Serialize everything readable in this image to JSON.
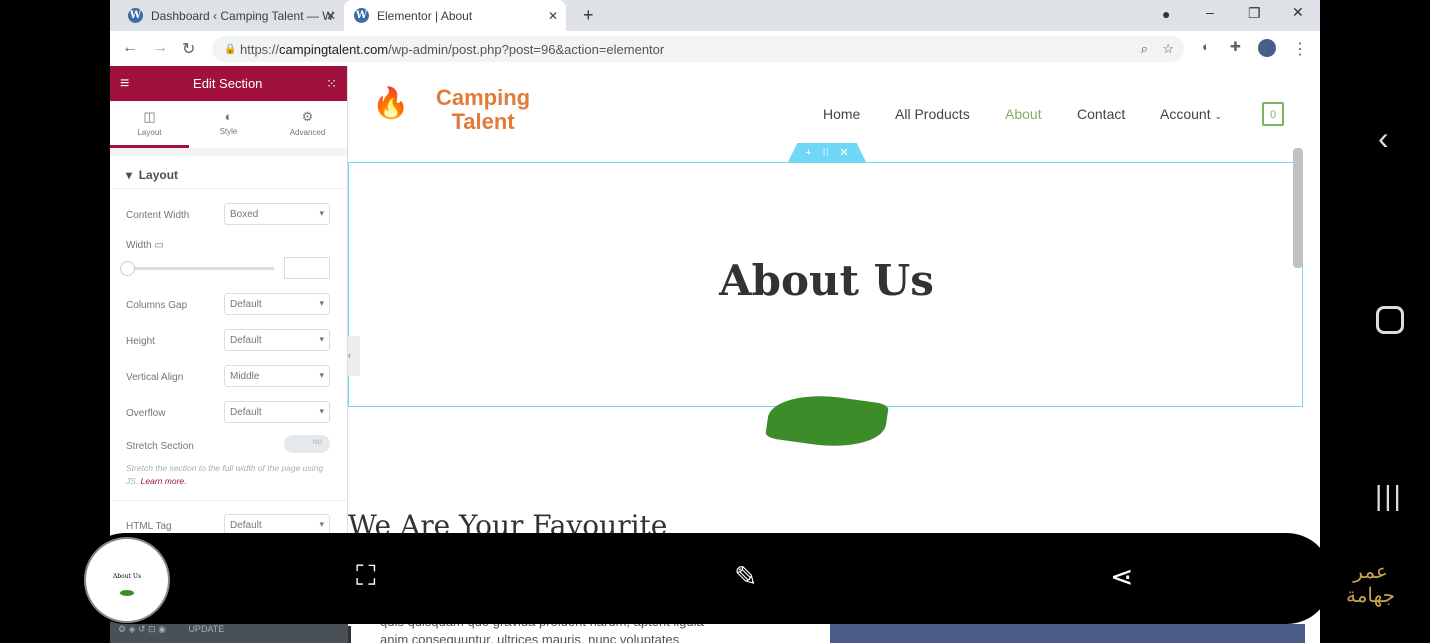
{
  "browser": {
    "tabs": [
      {
        "title": "Dashboard ‹ Camping Talent — W"
      },
      {
        "title": "Elementor | About"
      }
    ],
    "url_prefix": "https://",
    "url_domain": "campingtalent.com",
    "url_path": "/wp-admin/post.php?post=96&action=elementor"
  },
  "panel": {
    "title": "Edit Section",
    "tabs": [
      {
        "label": "Layout",
        "icon": "columns-icon"
      },
      {
        "label": "Style",
        "icon": "half-circle-icon"
      },
      {
        "label": "Advanced",
        "icon": "gear-icon"
      }
    ],
    "section_title": "Layout",
    "fields": {
      "content_width": {
        "label": "Content Width",
        "value": "Boxed"
      },
      "width": {
        "label": "Width"
      },
      "columns_gap": {
        "label": "Columns Gap",
        "value": "Default"
      },
      "height": {
        "label": "Height",
        "value": "Default"
      },
      "vertical_align": {
        "label": "Vertical Align",
        "value": "Middle"
      },
      "overflow": {
        "label": "Overflow",
        "value": "Default"
      },
      "stretch": {
        "label": "Stretch Section",
        "toggle": "NO",
        "help": "Stretch the section to the full width of the page using JS.",
        "learn": "Learn more."
      },
      "html_tag": {
        "label": "HTML Tag",
        "value": "Default"
      }
    },
    "update": "UPDATE"
  },
  "site": {
    "logo1": "Camping",
    "logo2": "Talent",
    "menu": [
      "Home",
      "All Products",
      "About",
      "Contact",
      "Account"
    ],
    "cart": "0",
    "heading": "About Us",
    "subheading": "We Are Your Favourite",
    "body1": "quis quisquam quo gravida proident harum, aptent ligula",
    "body2": "anim consequuntur, ultrices mauris, nunc voluptates"
  },
  "overlay": {
    "thumb_text": "About Us",
    "watermark1": "عمر",
    "watermark2": "جهامة"
  },
  "colors": {
    "accent": "#a0123d",
    "active_menu": "#7ab55c",
    "section_outline": "#71d7f7"
  }
}
